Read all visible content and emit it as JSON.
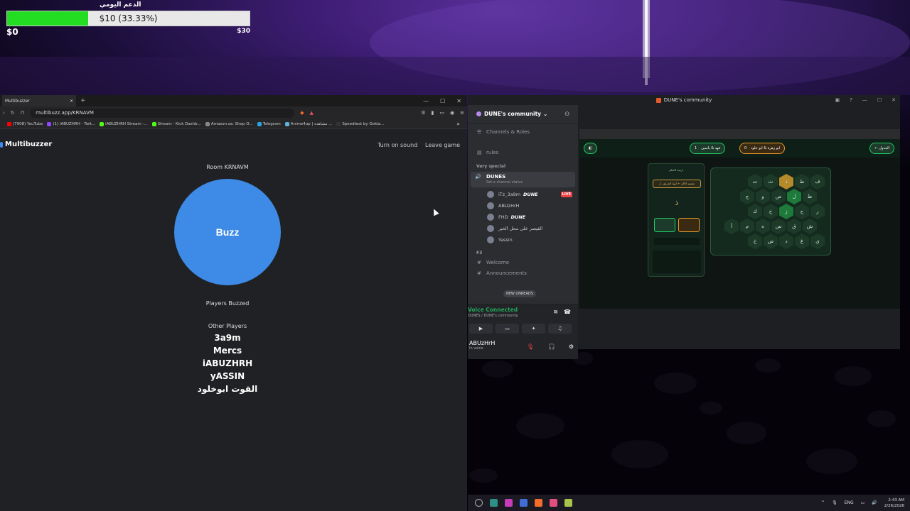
{
  "donation": {
    "title": "الدعم اليومي",
    "amount_text": "$10 (33.33%)",
    "progress_pct": 33.33,
    "min": "$0",
    "max": "$30"
  },
  "browser": {
    "tab_title": "Multibuzzer",
    "url": "multibuzz.app/KRNAVM",
    "bookmarks": [
      {
        "label": "(7908) YouTube",
        "color": "#ff0000"
      },
      {
        "label": "(1) iABUZHRH - Twit...",
        "color": "#9146ff"
      },
      {
        "label": "iABUZHRH Stream -...",
        "color": "#53fc18"
      },
      {
        "label": "Stream - Kick Dashb...",
        "color": "#53fc18"
      },
      {
        "label": "Amazon.sa: Shop O...",
        "color": "#888888"
      },
      {
        "label": "Telegram",
        "color": "#2aa3e0"
      },
      {
        "label": "Anime4up | مشاهدة ...",
        "color": "#5fb3d9"
      },
      {
        "label": "Speedtest by Ookla...",
        "color": "#333333"
      }
    ]
  },
  "multibuzzer": {
    "logo": "Multibuzzer",
    "turn_on_sound": "Turn on sound",
    "leave_game": "Leave game",
    "room": "Room KRNAVM",
    "buzz": "Buzz",
    "players_buzzed": "Players Buzzed",
    "other_players_label": "Other Players",
    "players": [
      "3a9m",
      "Mercs",
      "iABUZHRH",
      "yASSIN",
      "القوت ابوخلود"
    ]
  },
  "discord": {
    "window_title": "DUNE's community",
    "server_name": "DUNE's community",
    "channels_roles": "Channels & Roles",
    "rules": "rules",
    "category_special": "Very special",
    "voice_channel": "DUNES",
    "voice_status": "Set a channel status",
    "voice_users": [
      {
        "name": "iTz_3a9m",
        "badge": "DUNE",
        "live": "LIVE"
      },
      {
        "name": "ABUzHrH",
        "badge": "",
        "live": ""
      },
      {
        "name": "FHD",
        "badge": "DUNE",
        "live": ""
      },
      {
        "name": "القيصر على محل الخير",
        "badge": "",
        "live": ""
      },
      {
        "name": "Yassin",
        "badge": "",
        "live": ""
      }
    ],
    "category_f3": "F3",
    "channel_welcome": "Welcome",
    "channel_announcements": "Announcements",
    "new_unreads": "NEW UNREADS",
    "voice_connected": "Voice Connected",
    "voice_location": "DUNES / DUNE's community",
    "username": "ABUzHrH",
    "user_status": "In voice",
    "stream": {
      "team_left": "ابو زهرة & ابو خلود",
      "team_left_score": "0",
      "team_right": "فهد & ياسين",
      "team_right_score": "1",
      "back_btn": "← الجدول",
      "panel_title": "ارسة الحكم",
      "panel_btn": "متصم لاكام ← أسيا الحروف ل",
      "letter": "ذ",
      "letters": [
        [
          "ف",
          "ط",
          "ذ",
          "ث",
          "ت"
        ],
        [
          "ط",
          "ل",
          "ص",
          "و",
          "ج"
        ],
        [
          "ر",
          "ح",
          "ز",
          "خ",
          "ك"
        ],
        [
          "ش",
          "ق",
          "س",
          "ه",
          "م",
          "أ"
        ],
        [
          "ي",
          "غ",
          "د",
          "ض",
          "خ"
        ]
      ]
    }
  },
  "taskbar": {
    "lang": "ENG",
    "time": "2:43 AM",
    "date": "2/26/2026"
  }
}
